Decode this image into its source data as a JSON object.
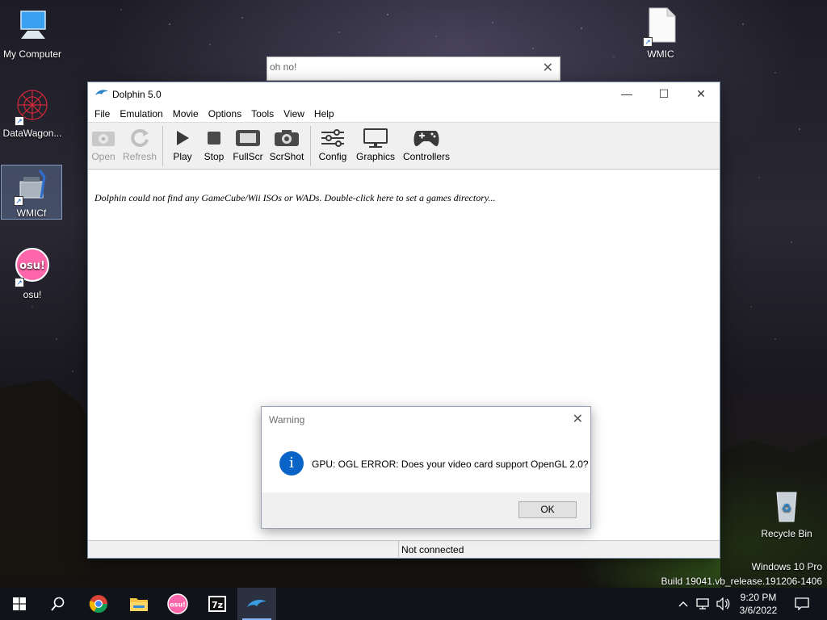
{
  "desktop": {
    "icons": [
      {
        "label": "My Computer"
      },
      {
        "label": "DataWagon..."
      },
      {
        "label": "WMICf"
      },
      {
        "label": "osu!"
      },
      {
        "label": "WMIC"
      },
      {
        "label": "Recycle Bin"
      }
    ],
    "watermark": {
      "edition": "Windows 10 Pro",
      "build": "Build 19041.vb_release.191206-1406"
    }
  },
  "ohno_window": {
    "title": "oh no!"
  },
  "dolphin_window": {
    "title": "Dolphin 5.0",
    "menu": [
      "File",
      "Emulation",
      "Movie",
      "Options",
      "Tools",
      "View",
      "Help"
    ],
    "toolbar": {
      "open": "Open",
      "refresh": "Refresh",
      "play": "Play",
      "stop": "Stop",
      "fullscr": "FullScr",
      "scrshot": "ScrShot",
      "config": "Config",
      "graphics": "Graphics",
      "controllers": "Controllers"
    },
    "empty_message": "Dolphin could not find any GameCube/Wii ISOs or WADs. Double-click here to set a games directory...",
    "status": "Not connected"
  },
  "warning_dialog": {
    "title": "Warning",
    "message": "GPU: OGL ERROR: Does your video card support OpenGL 2.0?",
    "ok_label": "OK",
    "icon": "info-icon"
  },
  "taskbar": {
    "apps": [
      "start-icon",
      "search-icon",
      "chrome-icon",
      "file-explorer-icon",
      "osu-icon",
      "7zip-icon",
      "dolphin-icon"
    ],
    "clock": {
      "time": "9:20 PM",
      "date": "3/6/2022"
    },
    "osu_glyph": "osu!",
    "sevenzip_glyph": "7z"
  },
  "colors": {
    "accent": "#0a64c8",
    "taskbar": "#10131a",
    "osu_pink": "#ff66aa"
  }
}
